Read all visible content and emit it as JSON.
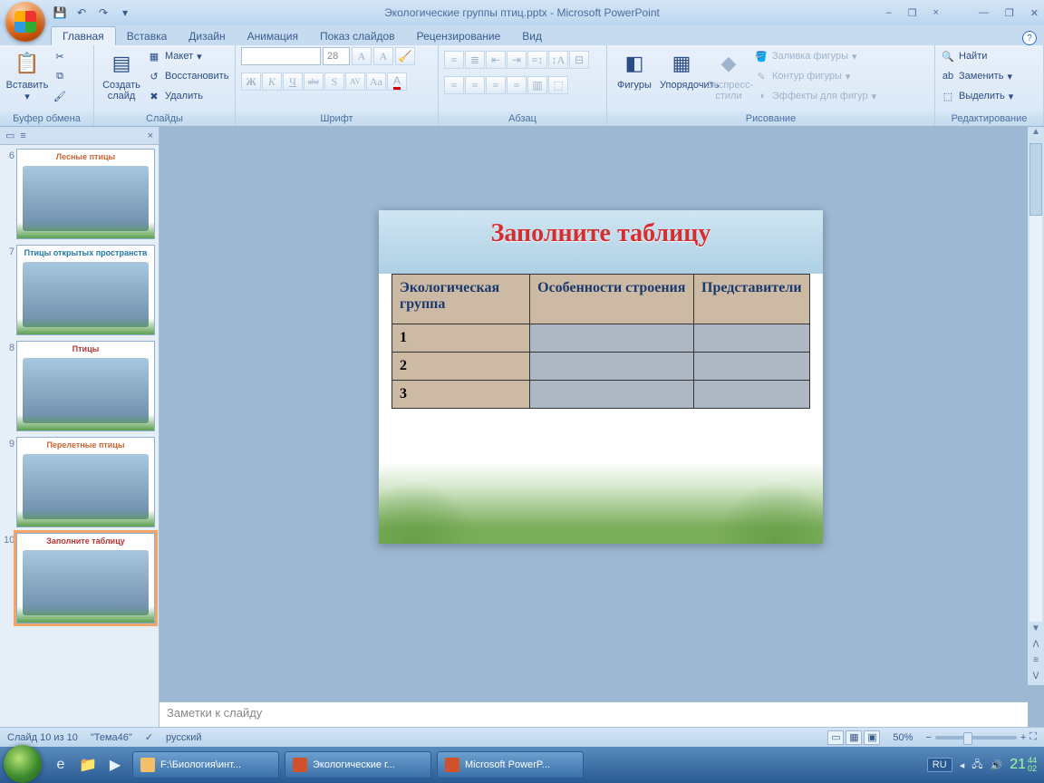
{
  "title": "Экологические группы птиц.pptx - Microsoft PowerPoint",
  "qat": {
    "save": "💾",
    "undo": "↶",
    "redo": "↷",
    "down": "▾"
  },
  "tabs": [
    "Главная",
    "Вставка",
    "Дизайн",
    "Анимация",
    "Показ слайдов",
    "Рецензирование",
    "Вид"
  ],
  "wincontrols": {
    "min": "—",
    "max": "❐",
    "close": "✕",
    "min2": "–",
    "restore": "❐",
    "close2": "×"
  },
  "groups": {
    "clipboard": {
      "label": "Буфер обмена",
      "paste": "Вставить",
      "cut": "✂",
      "copy": "⧉",
      "brush": "🖌"
    },
    "slides": {
      "label": "Слайды",
      "new": "Создать\nслайд",
      "layout": "Макет",
      "reset": "Восстановить",
      "delete": "Удалить"
    },
    "font": {
      "label": "Шрифт",
      "size": "28",
      "bold": "Ж",
      "italic": "К",
      "underline": "Ч",
      "strike": "abc",
      "shadow": "S",
      "spacing": "AV",
      "case": "Aa",
      "color": "A",
      "grow": "A",
      "shrink": "A",
      "clear": "A̸"
    },
    "para": {
      "label": "Абзац"
    },
    "drawing": {
      "label": "Рисование",
      "shapes": "Фигуры",
      "arrange": "Упорядочить",
      "styles": "Экспресс-стили",
      "fill": "Заливка фигуры",
      "outline": "Контур фигуры",
      "effects": "Эффекты для фигур"
    },
    "editing": {
      "label": "Редактирование",
      "find": "Найти",
      "replace": "Заменить",
      "select": "Выделить"
    }
  },
  "thumbs": [
    {
      "n": "6",
      "title": "Лесные птицы",
      "color": "#c63"
    },
    {
      "n": "7",
      "title": "Птицы открытых пространств",
      "color": "#27a"
    },
    {
      "n": "8",
      "title": "Птицы",
      "color": "#b33"
    },
    {
      "n": "9",
      "title": "Перелетные птицы",
      "color": "#c63"
    },
    {
      "n": "10",
      "title": "Заполните таблицу",
      "color": "#b33",
      "selected": true
    }
  ],
  "slide": {
    "title": "Заполните таблицу",
    "headers": [
      "Экологическая группа",
      "Особенности строения",
      "Представители"
    ],
    "rows": [
      "1",
      "2",
      "3"
    ]
  },
  "notes_placeholder": "Заметки к слайду",
  "status": {
    "slide": "Слайд 10 из 10",
    "theme": "\"Тема46\"",
    "lang": "русский",
    "zoom": "50%"
  },
  "taskbar": {
    "tasks": [
      {
        "label": "F:\\Биология\\инт...",
        "cls": ""
      },
      {
        "label": "Экологические г...",
        "cls": "ppt"
      },
      {
        "label": "Microsoft PowerP...",
        "cls": "ppt"
      }
    ],
    "lang": "RU",
    "time": "21",
    "min": "44",
    "sec": "02"
  }
}
